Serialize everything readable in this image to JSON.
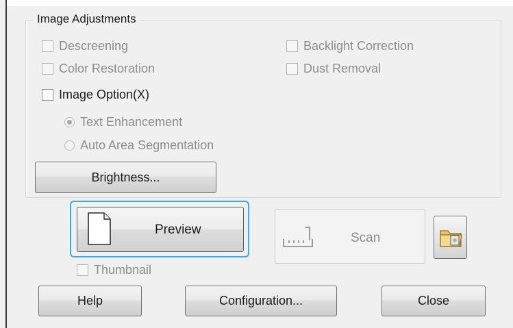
{
  "group": {
    "title": "Image Adjustments"
  },
  "checkboxes": {
    "descreening": "Descreening",
    "color_restoration": "Color Restoration",
    "backlight_correction": "Backlight Correction",
    "dust_removal": "Dust Removal",
    "image_option": "Image Option(X)"
  },
  "radios": {
    "text_enhancement": "Text Enhancement",
    "auto_area_segmentation": "Auto Area Segmentation"
  },
  "buttons": {
    "brightness": "Brightness...",
    "preview": "Preview",
    "scan": "Scan",
    "help": "Help",
    "configuration": "Configuration...",
    "close": "Close"
  },
  "thumbnail": "Thumbnail",
  "colors": {
    "focus_ring": "#3fa9e0",
    "disabled_text": "#8d8d8d"
  },
  "icons": {
    "preview": "document-icon",
    "scan": "scanner-icon",
    "folder": "folder-icon"
  }
}
